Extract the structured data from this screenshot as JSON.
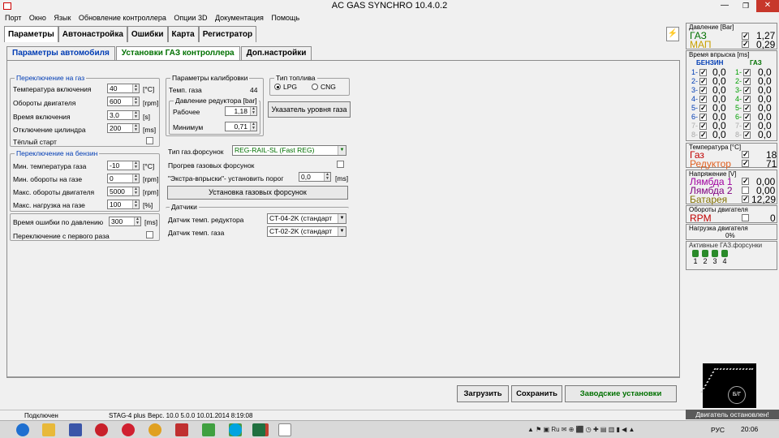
{
  "window": {
    "title": "AC GAS SYNCHRO  10.4.0.2"
  },
  "menu": [
    "Порт",
    "Окно",
    "Язык",
    "Обновление контроллера",
    "Опции 3D",
    "Документация",
    "Помощь"
  ],
  "main_tabs": [
    "Параметры",
    "Автонастройка",
    "Ошибки",
    "Карта",
    "Регистратор"
  ],
  "sub_tabs": [
    "Параметры автомобиля",
    "Установки ГАЗ контроллера",
    "Доп.настройки"
  ],
  "switch_gas": {
    "title": "Переключение на газ",
    "rows": [
      {
        "label": "Температура включения",
        "value": "40",
        "unit": "[°C]"
      },
      {
        "label": "Обороты двигателя",
        "value": "600",
        "unit": "[rpm]"
      },
      {
        "label": "Время включения",
        "value": "3,0",
        "unit": "[s]"
      },
      {
        "label": "Отключение цилиндра",
        "value": "200",
        "unit": "[ms]"
      }
    ],
    "warm_start": "Тёплый старт"
  },
  "switch_petrol": {
    "title": "Переключение на бензин",
    "rows": [
      {
        "label": "Мин. температура газа",
        "value": "-10",
        "unit": "[°C]"
      },
      {
        "label": "Мин. обороты на газе",
        "value": "0",
        "unit": "[rpm]"
      },
      {
        "label": "Макс. обороты двигателя",
        "value": "5000",
        "unit": "[rpm]"
      },
      {
        "label": "Макс. нагрузка на газе",
        "value": "100",
        "unit": "[%]"
      }
    ]
  },
  "pressure_error": {
    "label": "Время ошибки по давлению",
    "value": "300",
    "unit": "[ms]"
  },
  "first_switch": "Переключение с первого раза",
  "calibration": {
    "title": "Параметры калибровки",
    "gas_temp_label": "Темп. газа",
    "gas_temp_value": "44",
    "reducer_title": "Давление редуктора [bar]",
    "working_label": "Рабочее",
    "working_value": "1,18",
    "min_label": "Минимум",
    "min_value": "0,71"
  },
  "fuel_type": {
    "title": "Тип топлива",
    "lpg": "LPG",
    "cng": "CNG"
  },
  "level_button": "Указатель уровня газа",
  "injector_type": {
    "label": "Тип газ.форсунок",
    "value": "REG-RAIL-SL (Fast REG)"
  },
  "injector_warmup": "Прогрев газовых форсунок",
  "extra_inj": {
    "label": "\"Экстра-впрыски\"- установить порог",
    "value": "0,0",
    "unit": "[ms]"
  },
  "install_injectors_button": "Установка газовых форсунок",
  "sensors": {
    "title": "Датчики",
    "reducer_label": "Датчик темп. редуктора",
    "reducer_value": "CT-04-2K (стандарт",
    "gas_label": "Датчик темп. газа",
    "gas_value": "CT-02-2K (стандарт"
  },
  "footer_buttons": {
    "load": "Загрузить",
    "save": "Сохранить",
    "factory": "Заводские установки"
  },
  "status": {
    "connected": "Подключен",
    "device": "STAG-4 plus",
    "version": "Верс. 10.0  5.0.0   10.01.2014 8:19:08"
  },
  "right": {
    "pressure_title": "Давление [Bar]",
    "gas_label": "ГАЗ",
    "gas_value": "1,27",
    "map_label": "МАП",
    "map_value": "0,29",
    "inj_title": "Время впрыска [ms]",
    "petrol_header": "БЕНЗИН",
    "gas_header": "ГАЗ",
    "inj_rows": [
      "1",
      "2",
      "3",
      "4",
      "5",
      "6",
      "7",
      "8"
    ],
    "inj_value": "0,0",
    "temp_title": "Температура [°C]",
    "temp_gas_label": "Газ",
    "temp_gas_value": "18",
    "temp_red_label": "Редуктор",
    "temp_red_value": "71",
    "volt_title": "Напряжение [V]",
    "l1_label": "Лямбда 1",
    "l1_value": "0,00",
    "l2_label": "Лямбда 2",
    "l2_value": "0,00",
    "bat_label": "Батарея",
    "bat_value": "12,29",
    "rpm_title": "Обороты двигателя",
    "rpm_label": "RPM",
    "rpm_value": "0",
    "load_title": "Нагрузка двигателя",
    "load_value": "0%",
    "active_title": "Активные ГАЗ.форсунки",
    "active_nums": [
      "1",
      "2",
      "3",
      "4"
    ],
    "gauge_label": "Б/Г",
    "engine_stopped": "Двигатель остановлен!"
  },
  "taskbar": {
    "lang": "РУС",
    "time": "20:06"
  }
}
